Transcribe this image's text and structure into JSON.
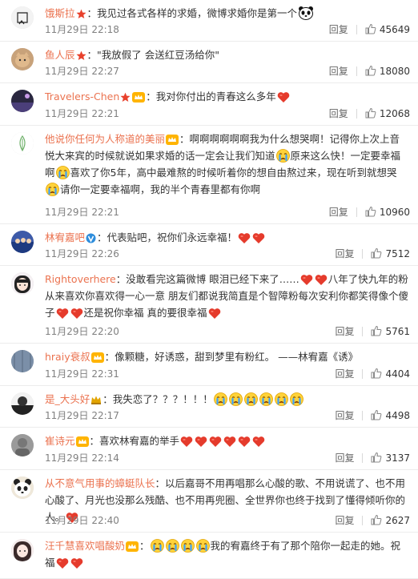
{
  "actions": {
    "reply_label": "回复"
  },
  "colors": {
    "username": "#eb7350",
    "meta": "#808080",
    "heart": "#e53b2c"
  },
  "comments": [
    {
      "username": "饿斯拉",
      "badges": [
        "star"
      ],
      "segments": [
        {
          "t": "我见过各式各样的求婚，微博求婚你是第一个"
        },
        {
          "e": "panda-icon"
        }
      ],
      "time": "11月29日 22:18",
      "likes": "45649"
    },
    {
      "username": "鱼人辰",
      "badges": [
        "star"
      ],
      "segments": [
        {
          "t": "\"我放假了 会送红豆汤给你\""
        }
      ],
      "time": "11月29日 22:27",
      "likes": "18080"
    },
    {
      "username": "Travelers-Chen",
      "badges": [
        "star",
        "crown"
      ],
      "segments": [
        {
          "t": "我对你付出的青春这么多年"
        },
        {
          "e": "heart-icon"
        }
      ],
      "time": "11月29日 22:21",
      "likes": "12068"
    },
    {
      "username": "他说你任何为人称道的美丽",
      "badges": [
        "crown"
      ],
      "segments": [
        {
          "t": "啊啊啊啊啊啊我为什么想哭啊！记得你上次上音悦大来宾的时候就说如果求婚的话一定会让我们知道"
        },
        {
          "e": "crying-face-icon"
        },
        {
          "t": "原来这么快！一定要幸福啊"
        },
        {
          "e": "crying-face-icon"
        },
        {
          "t": "喜欢了你5年，高中最难熬的时候听着你的想自由熬过来，现在听到就想哭"
        },
        {
          "e": "crying-face-icon"
        },
        {
          "t": "请你一定要幸福啊，我的半个青春里都有你啊"
        }
      ],
      "time": "11月29日 22:21",
      "likes": "10960"
    },
    {
      "username": "林宥嘉吧",
      "badges": [
        "vip"
      ],
      "segments": [
        {
          "t": "代表贴吧，祝你们永远幸福！"
        },
        {
          "e": "heart-icon"
        },
        {
          "e": "heart-icon"
        }
      ],
      "time": "11月29日 22:26",
      "likes": "7512"
    },
    {
      "username": "Rightoverhere",
      "badges": [],
      "segments": [
        {
          "t": "没敢看完这篇微博 眼泪已经下来了……"
        },
        {
          "e": "heart-icon"
        },
        {
          "e": "heart-icon"
        },
        {
          "t": "八年了快九年的粉 从来喜欢你喜欢得一心一意 朋友们都说我简直是个智障粉每次安利你都笑得像个傻子"
        },
        {
          "e": "heart-icon"
        },
        {
          "e": "heart-icon"
        },
        {
          "t": "还是祝你幸福 真的要很幸福"
        },
        {
          "e": "heart-icon"
        }
      ],
      "time": "11月29日 22:20",
      "likes": "5761"
    },
    {
      "username": "hraiy衰叔",
      "badges": [
        "crown"
      ],
      "segments": [
        {
          "t": "像颗糖，好诱惑，甜到梦里有粉红。 ——林宥嘉《诱》"
        }
      ],
      "time": "11月29日 22:31",
      "likes": "4404"
    },
    {
      "username": "是_大头好",
      "badges": [
        "crown2"
      ],
      "segments": [
        {
          "t": "我失恋了？？？！！！"
        },
        {
          "e": "crying-face-icon"
        },
        {
          "e": "crying-face-icon"
        },
        {
          "e": "crying-face-icon"
        },
        {
          "e": "crying-face-icon"
        },
        {
          "e": "crying-face-icon"
        },
        {
          "e": "crying-face-icon"
        }
      ],
      "time": "11月29日 22:17",
      "likes": "4498"
    },
    {
      "username": "崔诗元",
      "badges": [
        "crown"
      ],
      "segments": [
        {
          "t": "喜欢林宥嘉的举手"
        },
        {
          "e": "heart-icon"
        },
        {
          "e": "heart-icon"
        },
        {
          "e": "heart-icon"
        },
        {
          "e": "heart-icon"
        },
        {
          "e": "heart-icon"
        },
        {
          "e": "heart-icon"
        }
      ],
      "time": "11月29日 22:14",
      "likes": "3137"
    },
    {
      "username": "从不意气用事的蟑蜓队长",
      "badges": [],
      "segments": [
        {
          "t": "以后嘉哥不用再唱那么心酸的歌、不用说谎了、也不用心酸了、月光也没那么残酷、也不用再兜圈、全世界你也终于找到了懂得倾听你的人。"
        },
        {
          "e": "heart-icon"
        }
      ],
      "time": "11月29日 22:40",
      "likes": "2627"
    },
    {
      "username": "汪千慧喜欢唱酸奶",
      "badges": [
        "crown"
      ],
      "segments": [
        {
          "e": "crying-face-icon"
        },
        {
          "e": "crying-face-icon"
        },
        {
          "e": "crying-face-icon"
        },
        {
          "e": "crying-face-icon"
        },
        {
          "t": "我的宥嘉终于有了那个陪你一起走的她。祝福"
        },
        {
          "e": "heart-icon"
        },
        {
          "e": "heart-icon"
        }
      ],
      "time": "",
      "likes": ""
    }
  ]
}
